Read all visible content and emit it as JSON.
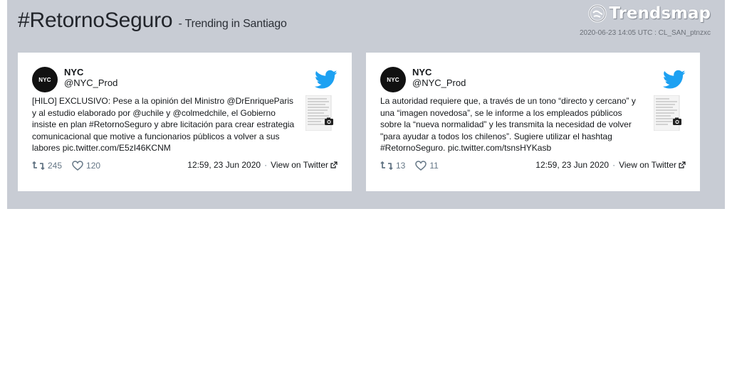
{
  "header": {
    "hashtag": "#RetornoSeguro",
    "subtitle": "- Trending in Santiago",
    "brand": "Trendsmap",
    "meta": "2020-06-23 14:05 UTC : CL_SAN_ptnzxc"
  },
  "tweets": [
    {
      "avatar_text": "NYC",
      "name": "NYC",
      "handle": "@NYC_Prod",
      "text": "[HILO] EXCLUSIVO: Pese a la opinión del Ministro @DrEnriqueParis y al estudio elaborado por @uchile y @colmedchile, el Gobierno insiste en plan #RetornoSeguro y abre licitación para crear estrategia comunicacional que motive a funcionarios públicos a volver a sus labores pic.twitter.com/E5zI46KCNM",
      "retweets": "245",
      "likes": "120",
      "time": "12:59, 23 Jun 2020",
      "view_label": "View on Twitter"
    },
    {
      "avatar_text": "NYC",
      "name": "NYC",
      "handle": "@NYC_Prod",
      "text": "La autoridad requiere que, a través de un tono “directo y cercano” y una “imagen novedosa”, se le informe a los empleados públicos sobre la “nueva normalidad” y les transmita la necesidad de volver \"para ayudar a todos los chilenos”. Sugiere utilizar el hashtag #RetornoSeguro. pic.twitter.com/tsnsHYKasb",
      "retweets": "13",
      "likes": "11",
      "time": "12:59, 23 Jun 2020",
      "view_label": "View on Twitter"
    }
  ],
  "colors": {
    "panel": "#c8ccd4",
    "twitter_blue": "#1da1f2",
    "action_gray": "#657786"
  },
  "icons": {
    "brand": "trendsmap-logo-icon",
    "bird": "twitter-bird-icon",
    "retweet": "retweet-icon",
    "like": "heart-icon",
    "external": "external-link-icon",
    "camera": "camera-icon"
  }
}
